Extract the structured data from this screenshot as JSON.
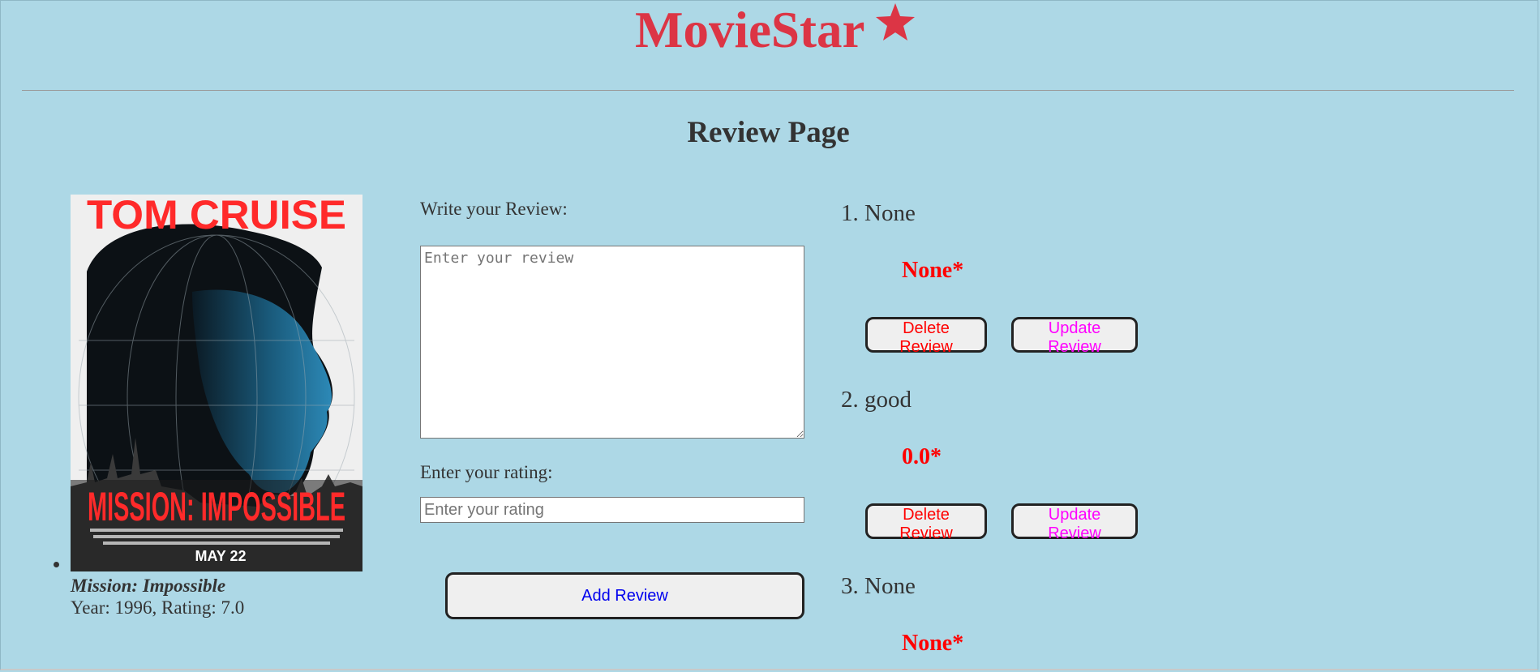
{
  "header": {
    "brand": "MovieStar",
    "brand_color": "#dc3545",
    "page_title": "Review Page"
  },
  "movie": {
    "poster_alt": "Mission: Impossible poster",
    "poster_text": {
      "top": "TOM CRUISE",
      "title": "MISSION: IMPOSSIBLE",
      "date": "MAY 22"
    },
    "title": "Mission: Impossible",
    "meta": "Year: 1996, Rating: 7.0"
  },
  "form": {
    "review_label": "Write your Review:",
    "review_placeholder": "Enter your review",
    "rating_label": "Enter your rating:",
    "rating_placeholder": "Enter your rating",
    "submit_label": "Add Review"
  },
  "reviews": [
    {
      "text": "1. None",
      "rating": "None*",
      "delete_label": "Delete Review",
      "update_label": "Update Review"
    },
    {
      "text": "2. good",
      "rating": "0.0*",
      "delete_label": "Delete Review",
      "update_label": "Update Review"
    },
    {
      "text": "3. None",
      "rating": "None*"
    }
  ],
  "colors": {
    "background": "#add8e6",
    "rating": "#ff0000",
    "delete": "#ff0000",
    "update": "#ff00ff",
    "add": "#0000ee"
  }
}
